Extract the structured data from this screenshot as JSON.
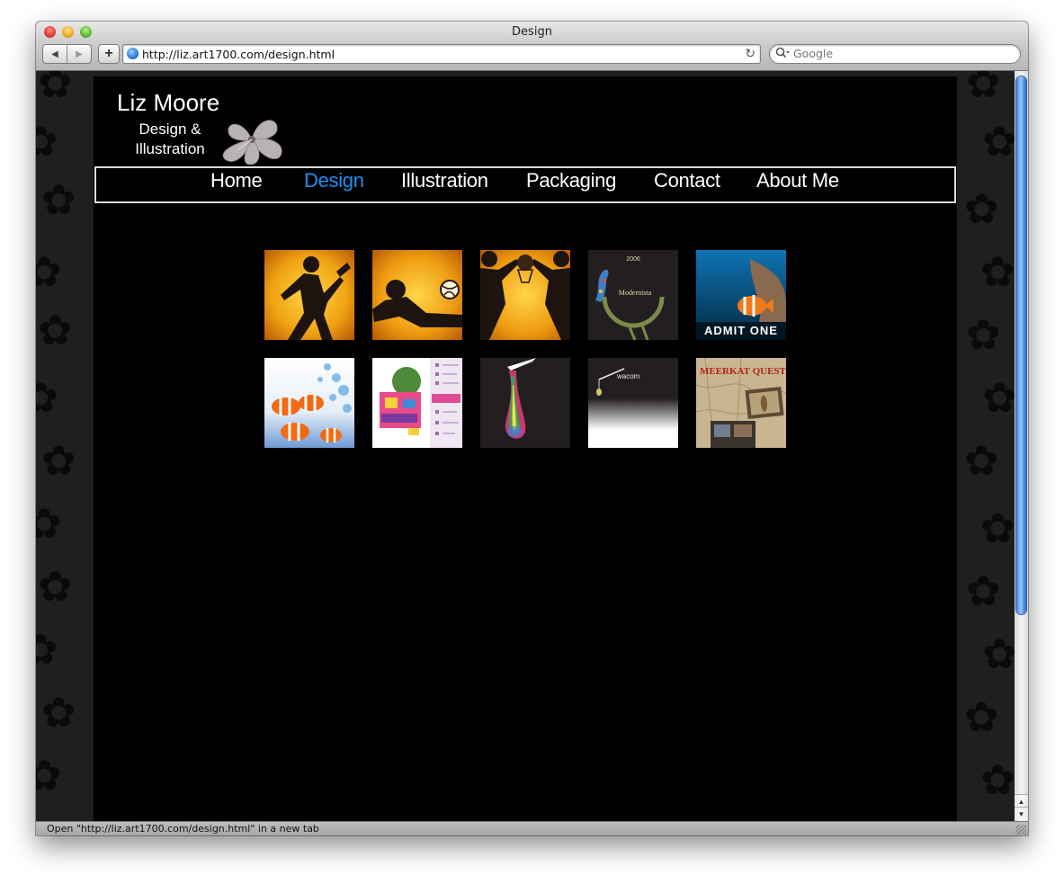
{
  "window": {
    "title": "Design"
  },
  "toolbar": {
    "back_glyph": "◀",
    "forward_glyph": "▶",
    "add_glyph": "+",
    "url": "http://liz.art1700.com/design.html",
    "reload_glyph": "↻",
    "search_placeholder": "Google"
  },
  "site": {
    "name": "Liz Moore",
    "tagline_1": "Design &",
    "tagline_2": "Illustration",
    "menu": [
      {
        "label": "Home",
        "active": false
      },
      {
        "label": "Design",
        "active": true
      },
      {
        "label": "Illustration",
        "active": false
      },
      {
        "label": "Packaging",
        "active": false
      },
      {
        "label": "Contact",
        "active": false
      },
      {
        "label": "About Me",
        "active": false
      }
    ],
    "accent_color": "#1f8ff2"
  },
  "gallery": [
    {
      "row": 1,
      "items": [
        {
          "name": "thumb-runner-relay",
          "caption": ""
        },
        {
          "name": "thumb-volleyball",
          "caption": ""
        },
        {
          "name": "thumb-basketball",
          "caption": ""
        },
        {
          "name": "thumb-modernista",
          "year": "2006",
          "caption": "Modernista"
        },
        {
          "name": "thumb-admit-one",
          "caption": "ADMIT ONE"
        }
      ]
    },
    {
      "row": 2,
      "items": [
        {
          "name": "thumb-clownfish-bubbles",
          "caption": ""
        },
        {
          "name": "thumb-explorer-brochure",
          "caption": ""
        },
        {
          "name": "thumb-paint-drip",
          "caption": ""
        },
        {
          "name": "thumb-wacom",
          "caption": "wacom"
        },
        {
          "name": "thumb-meerkat-quest",
          "caption": "MEERKAT QUEST"
        }
      ]
    }
  ],
  "status": {
    "text": "Open \"http://liz.art1700.com/design.html\" in a new tab"
  },
  "scrollbar": {
    "up_glyph": "▲",
    "down_glyph": "▼"
  }
}
